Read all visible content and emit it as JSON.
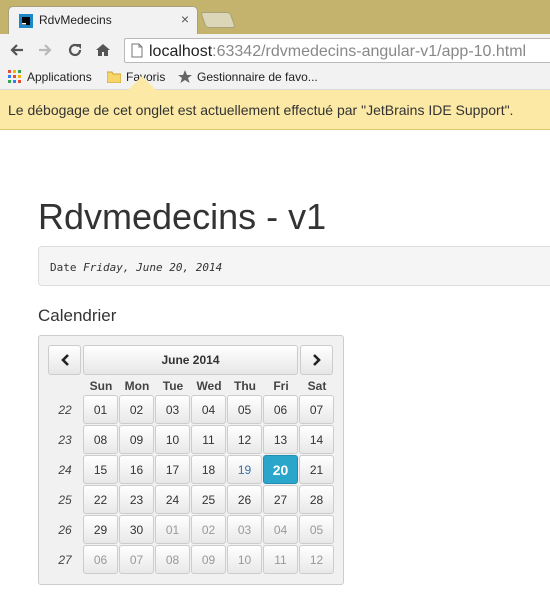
{
  "browser": {
    "tab_title": "RdvMedecins",
    "url_host": "localhost",
    "url_rest": ":63342/rdvmedecins-angular-v1/app-10.html",
    "bookmarks": [
      "Applications",
      "Favoris",
      "Gestionnaire de favo..."
    ],
    "infobar": "Le débogage de cet onglet est actuellement effectué par \"JetBrains IDE Support\"."
  },
  "page": {
    "title": "Rdvmedecins - v1",
    "date_label": "Date",
    "date_value": "Friday, June 20, 2014",
    "section": "Calendrier"
  },
  "calendar": {
    "month_label": "June 2014",
    "prev_icon": "chevron-left-icon",
    "next_icon": "chevron-right-icon",
    "days_of_week": [
      "Sun",
      "Mon",
      "Tue",
      "Wed",
      "Thu",
      "Fri",
      "Sat"
    ],
    "weeks": [
      {
        "num": "22",
        "days": [
          "01",
          "02",
          "03",
          "04",
          "05",
          "06",
          "07"
        ]
      },
      {
        "num": "23",
        "days": [
          "08",
          "09",
          "10",
          "11",
          "12",
          "13",
          "14"
        ]
      },
      {
        "num": "24",
        "days": [
          "15",
          "16",
          "17",
          "18",
          "19",
          "20",
          "21"
        ]
      },
      {
        "num": "25",
        "days": [
          "22",
          "23",
          "24",
          "25",
          "26",
          "27",
          "28"
        ]
      },
      {
        "num": "26",
        "days": [
          "29",
          "30",
          "01",
          "02",
          "03",
          "04",
          "05"
        ]
      },
      {
        "num": "27",
        "days": [
          "06",
          "07",
          "08",
          "09",
          "10",
          "11",
          "12"
        ]
      }
    ],
    "selected_day": "20",
    "today_day": "19"
  }
}
